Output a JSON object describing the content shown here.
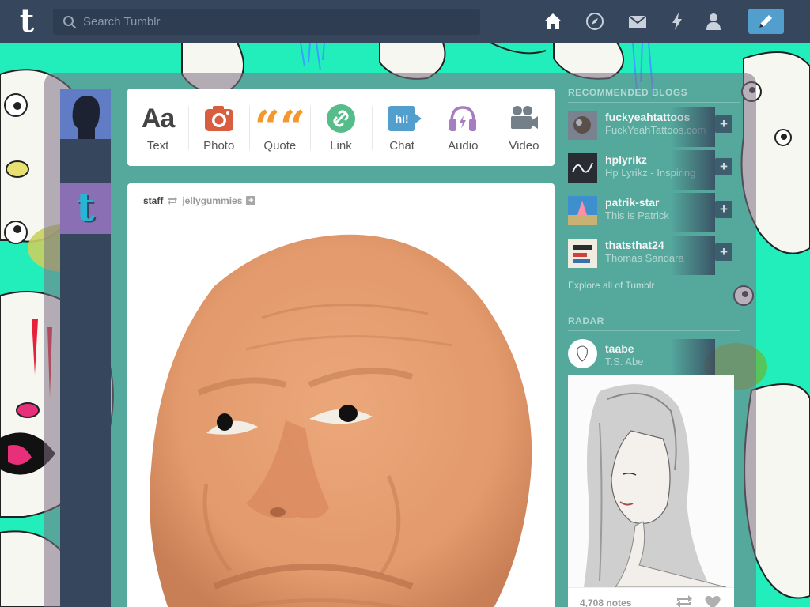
{
  "nav": {
    "logo_text": "t",
    "search_placeholder": "Search Tumblr",
    "icons": [
      "home-icon",
      "explore-icon",
      "inbox-icon",
      "activity-icon",
      "account-icon"
    ],
    "compose_icon": "pencil-icon",
    "accent_color": "#529ecc",
    "bar_color": "#36465d"
  },
  "sidebar_left": {
    "staff_logo_text": "t"
  },
  "post_types": [
    {
      "label": "Text",
      "icon": "text-icon",
      "glyph": "Aa",
      "color": "#444444"
    },
    {
      "label": "Photo",
      "icon": "camera-icon",
      "color": "#d95e40"
    },
    {
      "label": "Quote",
      "icon": "quote-icon",
      "glyph": "““",
      "color": "#f2992e"
    },
    {
      "label": "Link",
      "icon": "link-icon",
      "color": "#56bc8a"
    },
    {
      "label": "Chat",
      "icon": "chat-icon",
      "glyph": "hi!",
      "color": "#529ecc"
    },
    {
      "label": "Audio",
      "icon": "headphones-icon",
      "color": "#a77dc2"
    },
    {
      "label": "Video",
      "icon": "video-camera-icon",
      "color": "#748089"
    }
  ],
  "post": {
    "author": "staff",
    "reblogged_from": "jellygummies",
    "reblog_icon": "reblog-icon",
    "follow_icon": "plus-icon"
  },
  "recommended": {
    "title": "RECOMMENDED BLOGS",
    "blogs": [
      {
        "name": "fuckyeahtattoos",
        "subtitle": "FuckYeahTattoos.com"
      },
      {
        "name": "hplyrikz",
        "subtitle": "Hp Lyrikz - Inspiring"
      },
      {
        "name": "patrik-star",
        "subtitle": "This is Patrick"
      },
      {
        "name": "thatsthat24",
        "subtitle": "Thomas Sandara"
      }
    ],
    "explore_label": "Explore all of Tumblr"
  },
  "radar": {
    "title": "RADAR",
    "blog_name": "taabe",
    "blog_subtitle": "T.S. Abe",
    "notes": "4,708 notes"
  }
}
